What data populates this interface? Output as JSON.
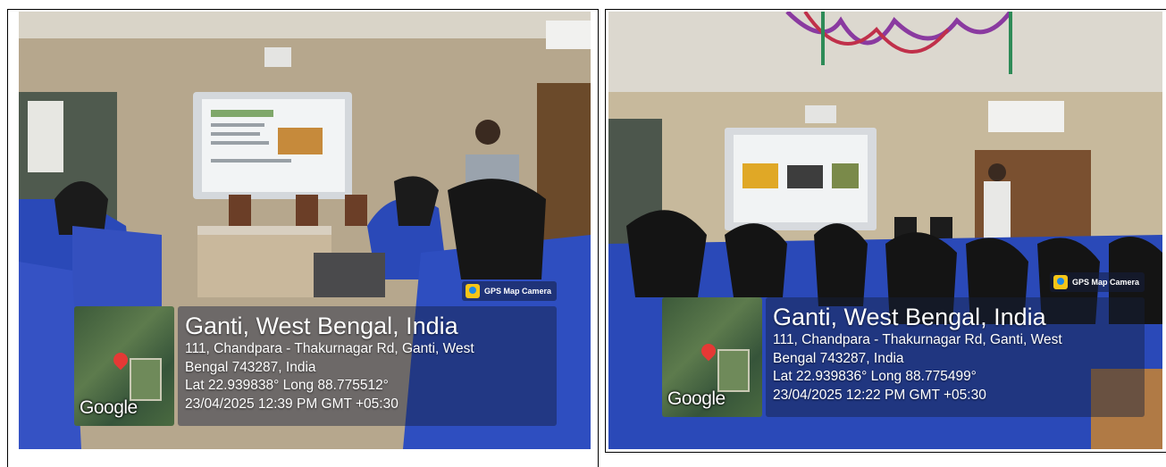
{
  "photos": [
    {
      "badge": "GPS Map Camera",
      "map_logo": "Google",
      "place": "Ganti, West Bengal, India",
      "address_line1": "111, Chandpara - Thakurnagar Rd, Ganti, West",
      "address_line2": "Bengal 743287, India",
      "coords": "Lat 22.939838° Long 88.775512°",
      "timestamp": "23/04/2025 12:39 PM GMT +05:30"
    },
    {
      "badge": "GPS Map Camera",
      "map_logo": "Google",
      "place": "Ganti, West Bengal, India",
      "address_line1": "111, Chandpara - Thakurnagar Rd, Ganti, West",
      "address_line2": "Bengal 743287, India",
      "coords": "Lat 22.939836° Long 88.775499°",
      "timestamp": "23/04/2025 12:22 PM GMT +05:30"
    }
  ],
  "colors": {
    "wall": "#b7a98f",
    "uniform_blue": "#2a49b8",
    "screen": "#e8ecef",
    "curtain": "#6b4a2a"
  }
}
